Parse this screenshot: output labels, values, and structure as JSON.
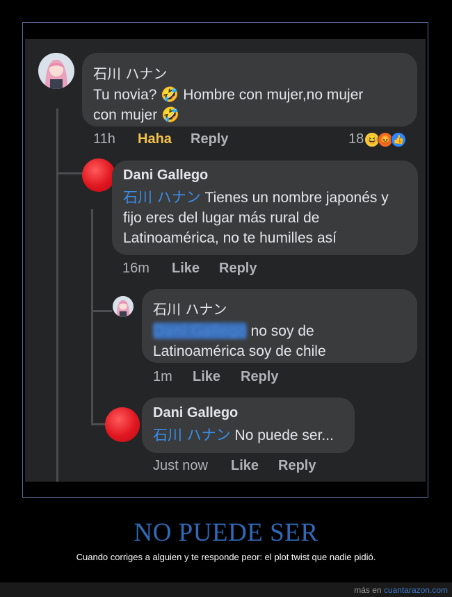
{
  "comments": [
    {
      "author": "石川 ハナン",
      "text_lines": [
        "Tu novia? 🤣 Hombre con mujer,no mujer",
        "con mujer 🤣"
      ],
      "time": "11h",
      "like_label": "Haha",
      "reply_label": "Reply",
      "reaction_count": "18",
      "reactions": [
        "laugh-emoji",
        "angry-emoji",
        "like-emoji"
      ]
    },
    {
      "author": "Dani Gallego",
      "mention": "石川 ハナン",
      "text_first": " Tienes un nombre japonés y",
      "text_lines": [
        "fijo eres del lugar más rural de",
        "Latinoamérica, no te humilles así"
      ],
      "time": "16m",
      "like_label": "Like",
      "reply_label": "Reply"
    },
    {
      "author": "石川 ハナン",
      "mention": "Dani Gallego",
      "text_first": " no soy de",
      "text_lines": [
        "Latinoamérica soy de chile"
      ],
      "time": "1m",
      "like_label": "Like",
      "reply_label": "Reply"
    },
    {
      "author": "Dani Gallego",
      "mention": "石川 ハナン",
      "text_first": " No puede ser...",
      "time": "Just now",
      "like_label": "Like",
      "reply_label": "Reply"
    }
  ],
  "post": {
    "title": "NO PUEDE SER",
    "caption": "Cuando corriges a alguien y te responde peor: el plot twist que nadie pidió."
  },
  "footer": {
    "prefix": "más en ",
    "site": "cuantarazon.com"
  }
}
